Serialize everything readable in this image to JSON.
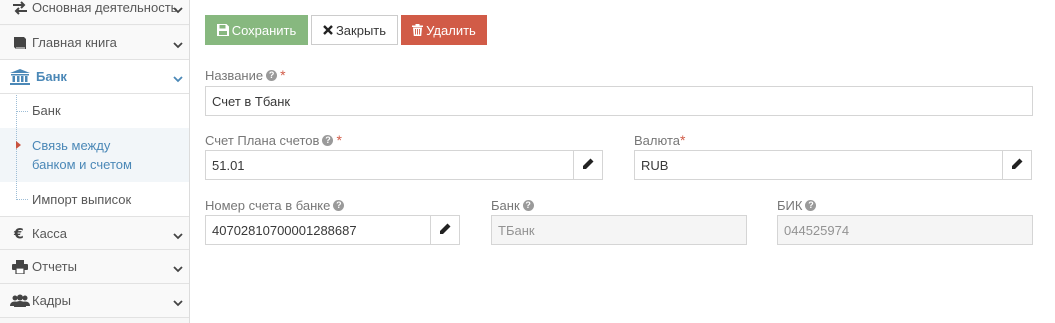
{
  "sidebar": {
    "items": [
      {
        "label": "Основная деятельность",
        "icon": "exchange-arrows-icon"
      },
      {
        "label": "Главная книга",
        "icon": "book-icon"
      },
      {
        "label": "Банк",
        "icon": "bank-icon"
      },
      {
        "label": "Касса",
        "icon": "euro-icon"
      },
      {
        "label": "Отчеты",
        "icon": "printer-icon"
      },
      {
        "label": "Кадры",
        "icon": "users-icon"
      }
    ],
    "bank_submenu": [
      {
        "label": "Банк"
      },
      {
        "label": "Связь между банком и счетом"
      },
      {
        "label": "Импорт выписок"
      }
    ]
  },
  "toolbar": {
    "save_label": "Сохранить",
    "close_label": "Закрыть",
    "delete_label": "Удалить"
  },
  "form": {
    "name": {
      "label": "Название",
      "value": "Счет в Тбанк"
    },
    "account_plan": {
      "label": "Счет Плана счетов",
      "value": "51.01"
    },
    "currency": {
      "label": "Валюта",
      "value": "RUB"
    },
    "bank_account_number": {
      "label": "Номер счета в банке",
      "value": "40702810700001288687"
    },
    "bank": {
      "label": "Банк",
      "value": "ТБанк"
    },
    "bik": {
      "label": "БИК",
      "value": "044525974"
    }
  },
  "colors": {
    "save": "#87b87f",
    "delete": "#d15b47",
    "active_nav": "#4b88b7",
    "required": "#d15b47"
  }
}
